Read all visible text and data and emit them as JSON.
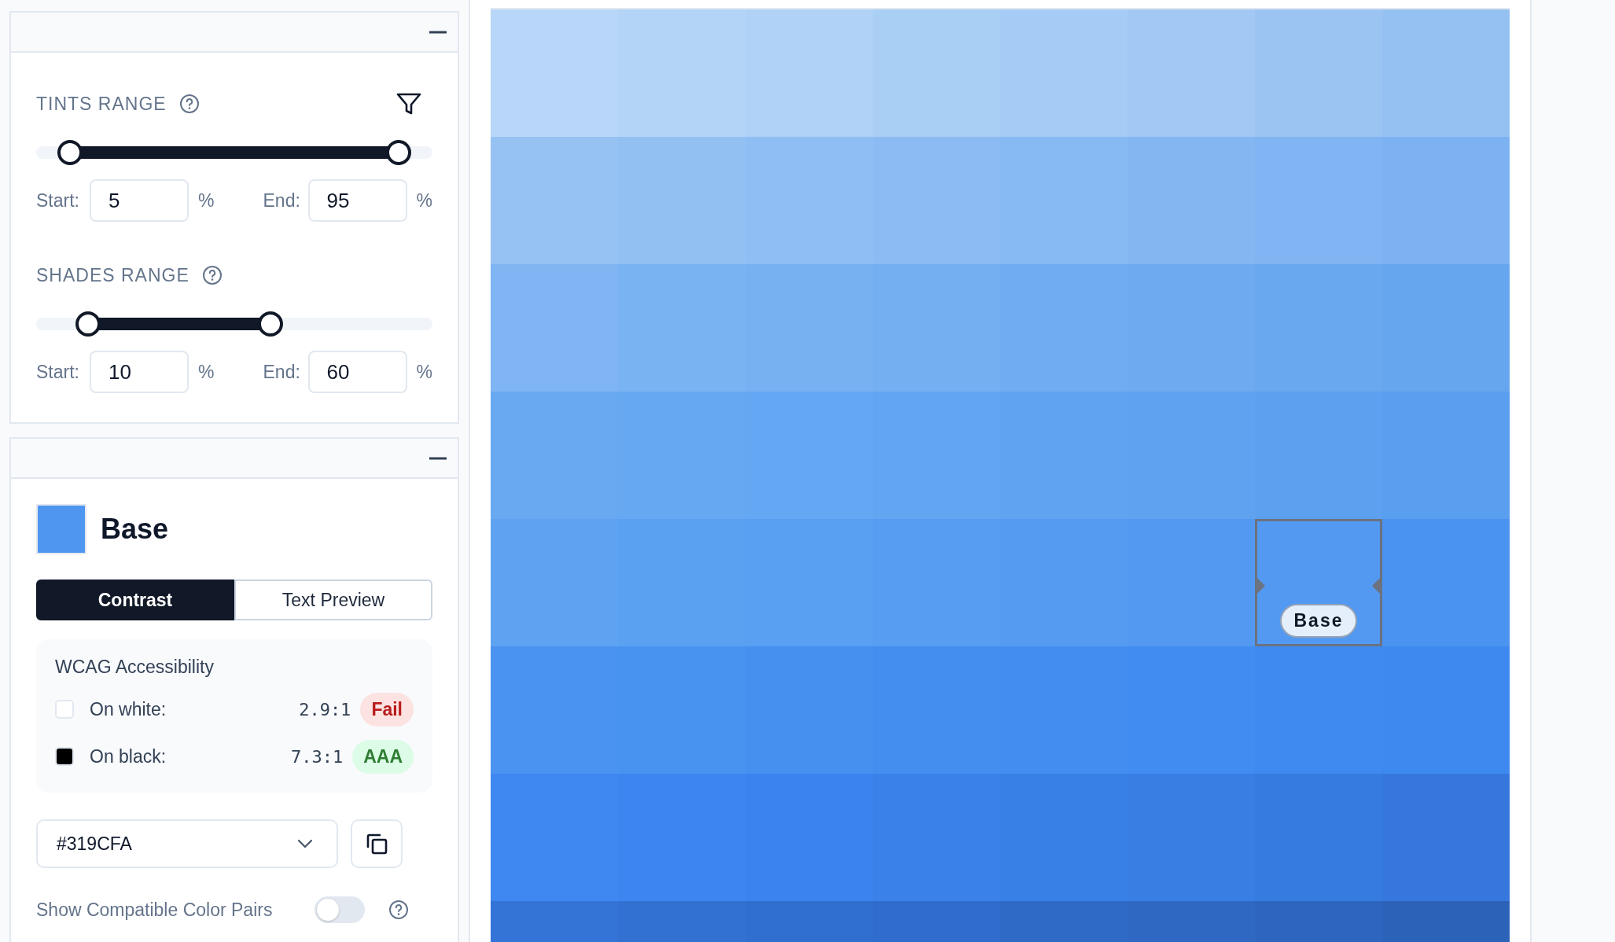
{
  "range_panel": {
    "ranges": [
      {
        "title": "TINTS RANGE",
        "slider": {
          "thumbs": [
            {
              "level": 0.05
            },
            {
              "level": 0.95
            }
          ]
        },
        "start_label": "Start:",
        "start_value": "5",
        "start_unit": "%",
        "end_label": "End:",
        "end_value": "95",
        "end_unit": "%"
      },
      {
        "title": "SHADES RANGE",
        "slider": {
          "thumbs": [
            {
              "level": 0.1
            },
            {
              "level": 0.6
            }
          ]
        },
        "start_label": "Start:",
        "start_value": "10",
        "start_unit": "%",
        "end_label": "End:",
        "end_value": "60",
        "end_unit": "%"
      }
    ]
  },
  "color_panel": {
    "swatch": {
      "color": "#4f96f0"
    },
    "name": "Base",
    "tabs": [
      {
        "label": "Contrast",
        "selected": true
      },
      {
        "label": "Text Preview",
        "selected": false
      }
    ],
    "wcag": {
      "title": "WCAG Accessibility",
      "rows": [
        {
          "color": "#ffffff",
          "label": "On white:",
          "ratio": "2.9:1",
          "result": "Fail",
          "kind": "fail"
        },
        {
          "color": "#000000",
          "label": "On black:",
          "ratio": "7.3:1",
          "result": "AAA",
          "kind": "pass"
        }
      ]
    },
    "hex_select": {
      "value": "#319CFA"
    },
    "toggle": {
      "label": "Show Compatible Color Pairs",
      "on": false
    }
  },
  "swatch_grid": {
    "rows": [
      {
        "cells": [
          {
            "color": "#b8d7f8",
            "selected": false
          },
          {
            "color": "#b3d4f7",
            "selected": false
          },
          {
            "color": "#afd2f6",
            "selected": false
          },
          {
            "color": "#aacff5",
            "selected": false
          },
          {
            "color": "#a6cbf4",
            "selected": false
          },
          {
            "color": "#a2c8f3",
            "selected": false
          },
          {
            "color": "#9cc4f2",
            "selected": false
          },
          {
            "color": "#95c1f2",
            "selected": false
          }
        ]
      },
      {
        "cells": [
          {
            "color": "#96c2f3",
            "selected": false
          },
          {
            "color": "#92c0f3",
            "selected": false
          },
          {
            "color": "#8ebef3",
            "selected": false
          },
          {
            "color": "#8bbbf2",
            "selected": false
          },
          {
            "color": "#87b9f2",
            "selected": false
          },
          {
            "color": "#84b7f2",
            "selected": false
          },
          {
            "color": "#80b4f2",
            "selected": false
          },
          {
            "color": "#7db2f2",
            "selected": false
          }
        ]
      },
      {
        "cells": [
          {
            "color": "#7eb5f2",
            "selected": false
          },
          {
            "color": "#7ab3f2",
            "selected": false
          },
          {
            "color": "#77b1f2",
            "selected": false
          },
          {
            "color": "#74aff2",
            "selected": false
          },
          {
            "color": "#70acf1",
            "selected": false
          },
          {
            "color": "#6daaf0",
            "selected": false
          },
          {
            "color": "#69a8ef",
            "selected": false
          },
          {
            "color": "#66a6ee",
            "selected": false
          }
        ]
      },
      {
        "cells": [
          {
            "color": "#68a9f2",
            "selected": false
          },
          {
            "color": "#66a8f2",
            "selected": false
          },
          {
            "color": "#64a7f2",
            "selected": false
          },
          {
            "color": "#62a5f1",
            "selected": false
          },
          {
            "color": "#60a3f0",
            "selected": false
          },
          {
            "color": "#5ea2f0",
            "selected": false
          },
          {
            "color": "#5ca0ef",
            "selected": false
          },
          {
            "color": "#5a9eef",
            "selected": false
          }
        ]
      },
      {
        "cells": [
          {
            "color": "#5ea3f2",
            "selected": false
          },
          {
            "color": "#5ba1f2",
            "selected": false
          },
          {
            "color": "#599ff2",
            "selected": false
          },
          {
            "color": "#579df2",
            "selected": false
          },
          {
            "color": "#559bf1",
            "selected": false
          },
          {
            "color": "#5399f1",
            "selected": false
          },
          {
            "color": "#5399f1",
            "selected": true,
            "label": "Base"
          },
          {
            "color": "#4a93ef",
            "selected": false
          }
        ]
      },
      {
        "cells": [
          {
            "color": "#4a93f0",
            "selected": false
          },
          {
            "color": "#4892f0",
            "selected": false
          },
          {
            "color": "#4690f0",
            "selected": false
          },
          {
            "color": "#448ef0",
            "selected": false
          },
          {
            "color": "#438df0",
            "selected": false
          },
          {
            "color": "#418cf0",
            "selected": false
          },
          {
            "color": "#3f8af0",
            "selected": false
          },
          {
            "color": "#3d89ef",
            "selected": false
          }
        ]
      },
      {
        "cells": [
          {
            "color": "#3f88f1",
            "selected": false
          },
          {
            "color": "#3d86f1",
            "selected": false
          },
          {
            "color": "#3b84f0",
            "selected": false
          },
          {
            "color": "#3a82ea",
            "selected": false
          },
          {
            "color": "#3980e6",
            "selected": false
          },
          {
            "color": "#387ee3",
            "selected": false
          },
          {
            "color": "#367be0",
            "selected": false
          },
          {
            "color": "#3577dc",
            "selected": false
          }
        ]
      },
      {
        "cells": [
          {
            "color": "#3374d6",
            "selected": false
          },
          {
            "color": "#3271d2",
            "selected": false
          },
          {
            "color": "#316fcf",
            "selected": false
          },
          {
            "color": "#306ccb",
            "selected": false
          },
          {
            "color": "#2f6ac7",
            "selected": false
          },
          {
            "color": "#2e68c3",
            "selected": false
          },
          {
            "color": "#2d65bf",
            "selected": false
          },
          {
            "color": "#2c62b8",
            "selected": false
          }
        ]
      }
    ]
  }
}
